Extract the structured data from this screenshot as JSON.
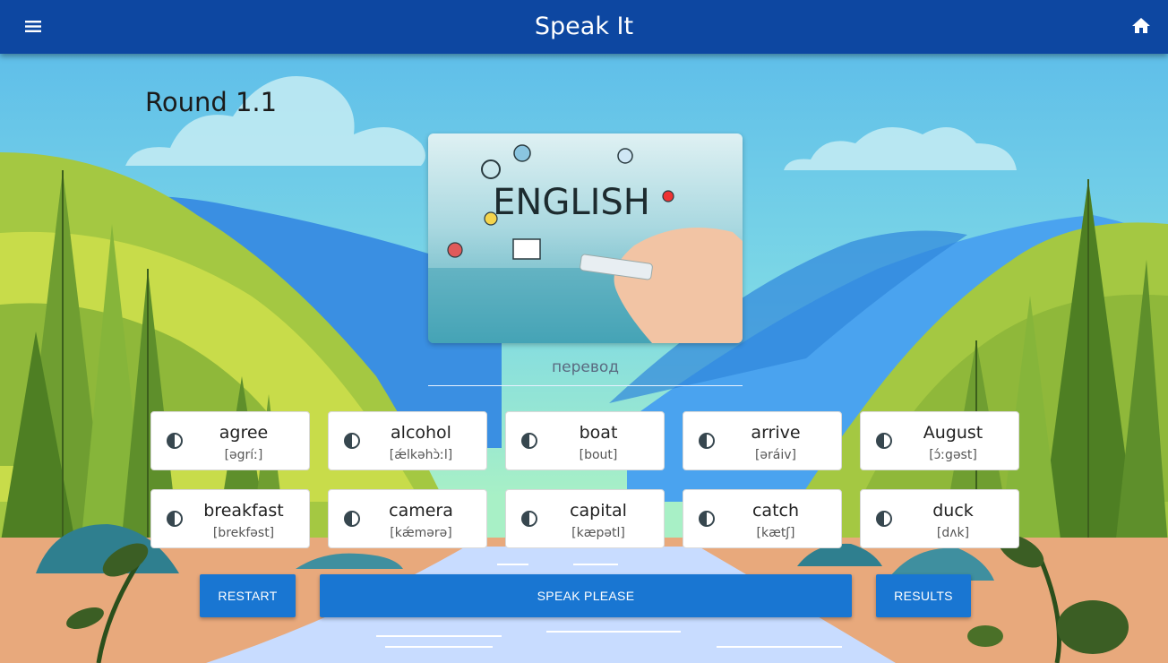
{
  "header": {
    "title": "Speak It",
    "menu_icon": "menu-icon",
    "home_icon": "home-icon",
    "color": "#0d47a1"
  },
  "game": {
    "round_label": "Round 1.1",
    "translation_placeholder": "перевод",
    "image": {
      "text": "ENGLISH"
    }
  },
  "words": [
    {
      "word": "agree",
      "transcription": "[əgríː]"
    },
    {
      "word": "alcohol",
      "transcription": "[ǽlkəhɔ̀ːl]"
    },
    {
      "word": "boat",
      "transcription": "[bout]"
    },
    {
      "word": "arrive",
      "transcription": "[əráiv]"
    },
    {
      "word": "August",
      "transcription": "[ɔ́ːgəst]"
    },
    {
      "word": "breakfast",
      "transcription": "[brekfəst]"
    },
    {
      "word": "camera",
      "transcription": "[kǽmərə]"
    },
    {
      "word": "capital",
      "transcription": "[kæpətl]"
    },
    {
      "word": "catch",
      "transcription": "[kætʃ]"
    },
    {
      "word": "duck",
      "transcription": "[dʌk]"
    }
  ],
  "buttons": {
    "restart": "Restart",
    "speak": "Speak please",
    "results": "Results",
    "color": "#1976d2"
  }
}
